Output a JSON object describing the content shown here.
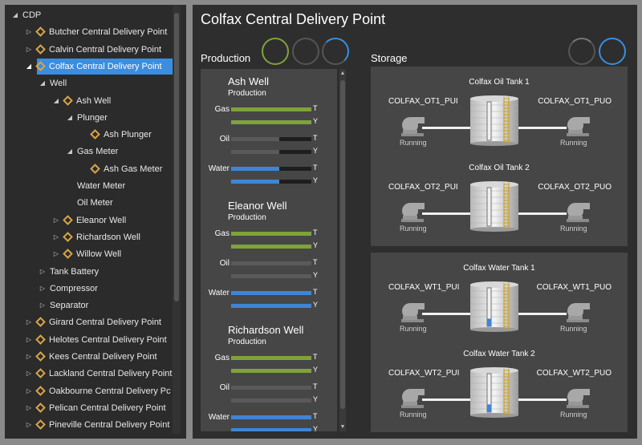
{
  "tree": {
    "items": [
      {
        "label": "CDP",
        "depth": 0,
        "arrow": "down",
        "diamond": false
      },
      {
        "label": "Butcher Central Delivery Point",
        "depth": 1,
        "arrow": "right",
        "diamond": true
      },
      {
        "label": "Calvin Central Delivery Point",
        "depth": 1,
        "arrow": "right",
        "diamond": true
      },
      {
        "label": "Colfax Central Delivery Point",
        "depth": 1,
        "arrow": "down",
        "diamond": true,
        "selected": true
      },
      {
        "label": "Well",
        "depth": 2,
        "arrow": "down",
        "diamond": false
      },
      {
        "label": "Ash Well",
        "depth": 3,
        "arrow": "down",
        "diamond": true
      },
      {
        "label": "Plunger",
        "depth": 4,
        "arrow": "down",
        "diamond": false
      },
      {
        "label": "Ash Plunger",
        "depth": 5,
        "arrow": "",
        "diamond": true
      },
      {
        "label": "Gas Meter",
        "depth": 4,
        "arrow": "down",
        "diamond": false
      },
      {
        "label": "Ash Gas Meter",
        "depth": 5,
        "arrow": "",
        "diamond": true
      },
      {
        "label": "Water Meter",
        "depth": 4,
        "arrow": "",
        "diamond": false
      },
      {
        "label": "Oil Meter",
        "depth": 4,
        "arrow": "",
        "diamond": false
      },
      {
        "label": "Eleanor Well",
        "depth": 3,
        "arrow": "right",
        "diamond": true
      },
      {
        "label": "Richardson Well",
        "depth": 3,
        "arrow": "right",
        "diamond": true
      },
      {
        "label": "Willow Well",
        "depth": 3,
        "arrow": "right",
        "diamond": true
      },
      {
        "label": "Tank Battery",
        "depth": 2,
        "arrow": "right",
        "diamond": false
      },
      {
        "label": "Compressor",
        "depth": 2,
        "arrow": "right",
        "diamond": false
      },
      {
        "label": "Separator",
        "depth": 2,
        "arrow": "right",
        "diamond": false
      },
      {
        "label": "Girard Central Delivery Point",
        "depth": 1,
        "arrow": "right",
        "diamond": true
      },
      {
        "label": "Helotes Central Delivery Point",
        "depth": 1,
        "arrow": "right",
        "diamond": true
      },
      {
        "label": "Kees Central Delivery Point",
        "depth": 1,
        "arrow": "right",
        "diamond": true
      },
      {
        "label": "Lackland Central Delivery Point",
        "depth": 1,
        "arrow": "right",
        "diamond": true
      },
      {
        "label": "Oakbourne Central Delivery Pc",
        "depth": 1,
        "arrow": "right",
        "diamond": true
      },
      {
        "label": "Pelican Central Delivery Point",
        "depth": 1,
        "arrow": "right",
        "diamond": true
      },
      {
        "label": "Pineville Central Delivery Point",
        "depth": 1,
        "arrow": "right",
        "diamond": true
      }
    ]
  },
  "main": {
    "title": "Colfax Central Delivery Point",
    "production_label": "Production",
    "storage_label": "Storage"
  },
  "colors": {
    "gas": "#7fa33a",
    "oil": "#5a5a5a",
    "water": "#3f85d6",
    "accent": "#3b8de0"
  },
  "wells": [
    {
      "name": "Ash Well",
      "sub": "Production",
      "meters": [
        {
          "label": "Gas",
          "t": 1.0,
          "y": 1.0,
          "color": "gas"
        },
        {
          "label": "Oil",
          "t": 0.6,
          "y": 0.6,
          "color": "oil"
        },
        {
          "label": "Water",
          "t": 0.6,
          "y": 0.6,
          "color": "water"
        }
      ]
    },
    {
      "name": "Eleanor Well",
      "sub": "Production",
      "meters": [
        {
          "label": "Gas",
          "t": 1.0,
          "y": 1.0,
          "color": "gas"
        },
        {
          "label": "Oil",
          "t": 1.0,
          "y": 1.0,
          "color": "oil"
        },
        {
          "label": "Water",
          "t": 1.0,
          "y": 1.0,
          "color": "water"
        }
      ]
    },
    {
      "name": "Richardson Well",
      "sub": "Production",
      "meters": [
        {
          "label": "Gas",
          "t": 1.0,
          "y": 1.0,
          "color": "gas"
        },
        {
          "label": "Oil",
          "t": 1.0,
          "y": 1.0,
          "color": "oil"
        },
        {
          "label": "Water",
          "t": 1.0,
          "y": 1.0,
          "color": "water"
        }
      ]
    }
  ],
  "bar_tags": {
    "t": "T",
    "y": "Y"
  },
  "oil_tanks": [
    {
      "title": "Colfax Oil Tank 1",
      "inlet": "COLFAX_OT1_PUI",
      "outlet": "COLFAX_OT1_PUO",
      "in_status": "Running",
      "out_status": "Running",
      "level": 0.0
    },
    {
      "title": "Colfax Oil Tank 2",
      "inlet": "COLFAX_OT2_PUI",
      "outlet": "COLFAX_OT2_PUO",
      "in_status": "Running",
      "out_status": "Running",
      "level": 0.0
    }
  ],
  "water_tanks": [
    {
      "title": "Colfax Water Tank 1",
      "inlet": "COLFAX_WT1_PUI",
      "outlet": "COLFAX_WT1_PUO",
      "in_status": "Running",
      "out_status": "Running",
      "level": 0.2
    },
    {
      "title": "Colfax Water Tank 2",
      "inlet": "COLFAX_WT2_PUI",
      "outlet": "COLFAX_WT2_PUO",
      "in_status": "Running",
      "out_status": "Running",
      "level": 0.2
    }
  ]
}
